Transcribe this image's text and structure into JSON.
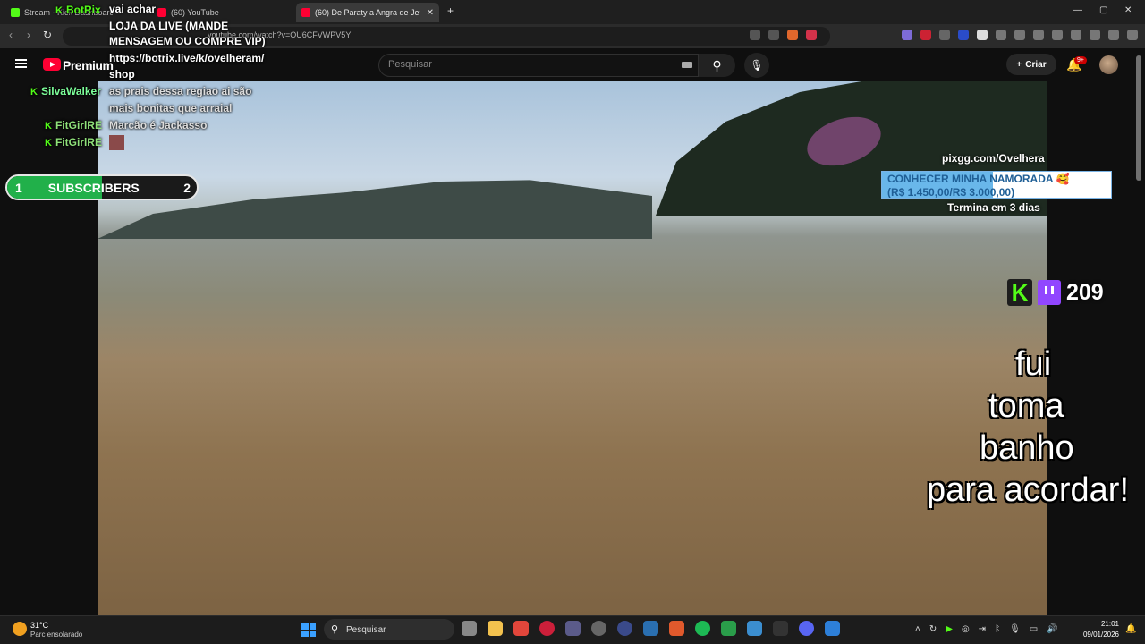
{
  "browser": {
    "tabs": [
      {
        "title": "Stream - Kick Dashboard",
        "favicon_color": "#53fc18"
      },
      {
        "title": "(60) YouTube",
        "favicon_color": "#ff0033"
      },
      {
        "title": "(60) De Paraty a Angra de Jet",
        "favicon_color": "#ff0033",
        "active": true
      }
    ],
    "new_tab": "+",
    "window_controls": [
      "—",
      "▢",
      "✕"
    ],
    "url": "youtube.com/watch?v=OU6CFVWPV5Y"
  },
  "youtube": {
    "brand": "Premium",
    "search_placeholder": "Pesquisar",
    "create_label": "Criar",
    "notification_count": "9+"
  },
  "chat": [
    {
      "user": "BotRix",
      "user_color": "#53fc18",
      "lines": [
        "vai achar",
        "LOJA DA LIVE (MANDE",
        "MENSAGEM OU COMPRE VIP)",
        "https://botrix.live/k/ovelheram/",
        "shop"
      ]
    },
    {
      "user": "SilvaWalker",
      "user_color": "#7dff9a",
      "lines": [
        "as prais dessa regiao ai são",
        "mais bonitas que arraial"
      ]
    },
    {
      "user": "FitGirlRE",
      "user_color": "#8fe07a",
      "lines": [
        "Marcão é Jackasso"
      ]
    },
    {
      "user": "FitGirlRE",
      "user_color": "#8fe07a",
      "lines": [],
      "emote": true
    }
  ],
  "subscribers_bar": {
    "current": "1",
    "label": "SUBSCRIBERS",
    "goal": "2",
    "progress": 0.5
  },
  "pix_goal": {
    "url": "pixgg.com/Ovelhera",
    "title": "CONHECER MINHA NAMORADA 🥰",
    "amount": "(R$ 1.450,00/R$ 3.000,00)",
    "progress": 0.483,
    "ends": "Termina em 3 dias"
  },
  "viewer_count": "209",
  "caption_lines": [
    "fui",
    "toma",
    "banho",
    "para acordar!"
  ],
  "taskbar": {
    "temperature": "31°C",
    "condition": "Parc ensolarado",
    "search_label": "Pesquisar",
    "time": "21:01",
    "date": "09/01/2026"
  }
}
